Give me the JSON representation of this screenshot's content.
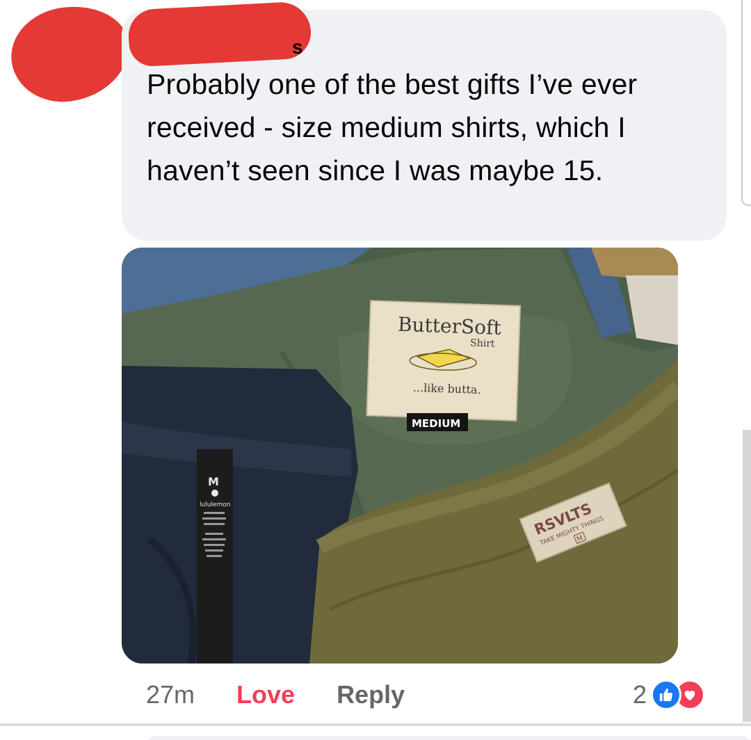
{
  "comment": {
    "author_visible": "s",
    "text": "Probably one of the best gifts I’ve ever received - size medium shirts, which I haven’t seen since I was maybe 15.",
    "time": "27m",
    "reaction_label": "Love",
    "reply_label": "Reply",
    "reaction_count": "2",
    "reaction_icons": [
      "like-icon",
      "love-icon"
    ]
  },
  "photo": {
    "labels": {
      "buttersoft_brand": "ButterSoft",
      "buttersoft_sub": "Shirt",
      "buttersoft_tagline": "...like butta.",
      "buttersoft_size": "MEDIUM",
      "lululemon_size": "M",
      "lululemon_brand": "lululemon",
      "rsvlts_brand": "RSVLTS",
      "rsvlts_tagline": "TAKE MIGHTY THINGS",
      "rsvlts_size": "M"
    }
  },
  "colors": {
    "bubble": "#eff1f4",
    "love": "#f33e58",
    "like": "#1877f2",
    "secondary_text": "#65676b"
  }
}
